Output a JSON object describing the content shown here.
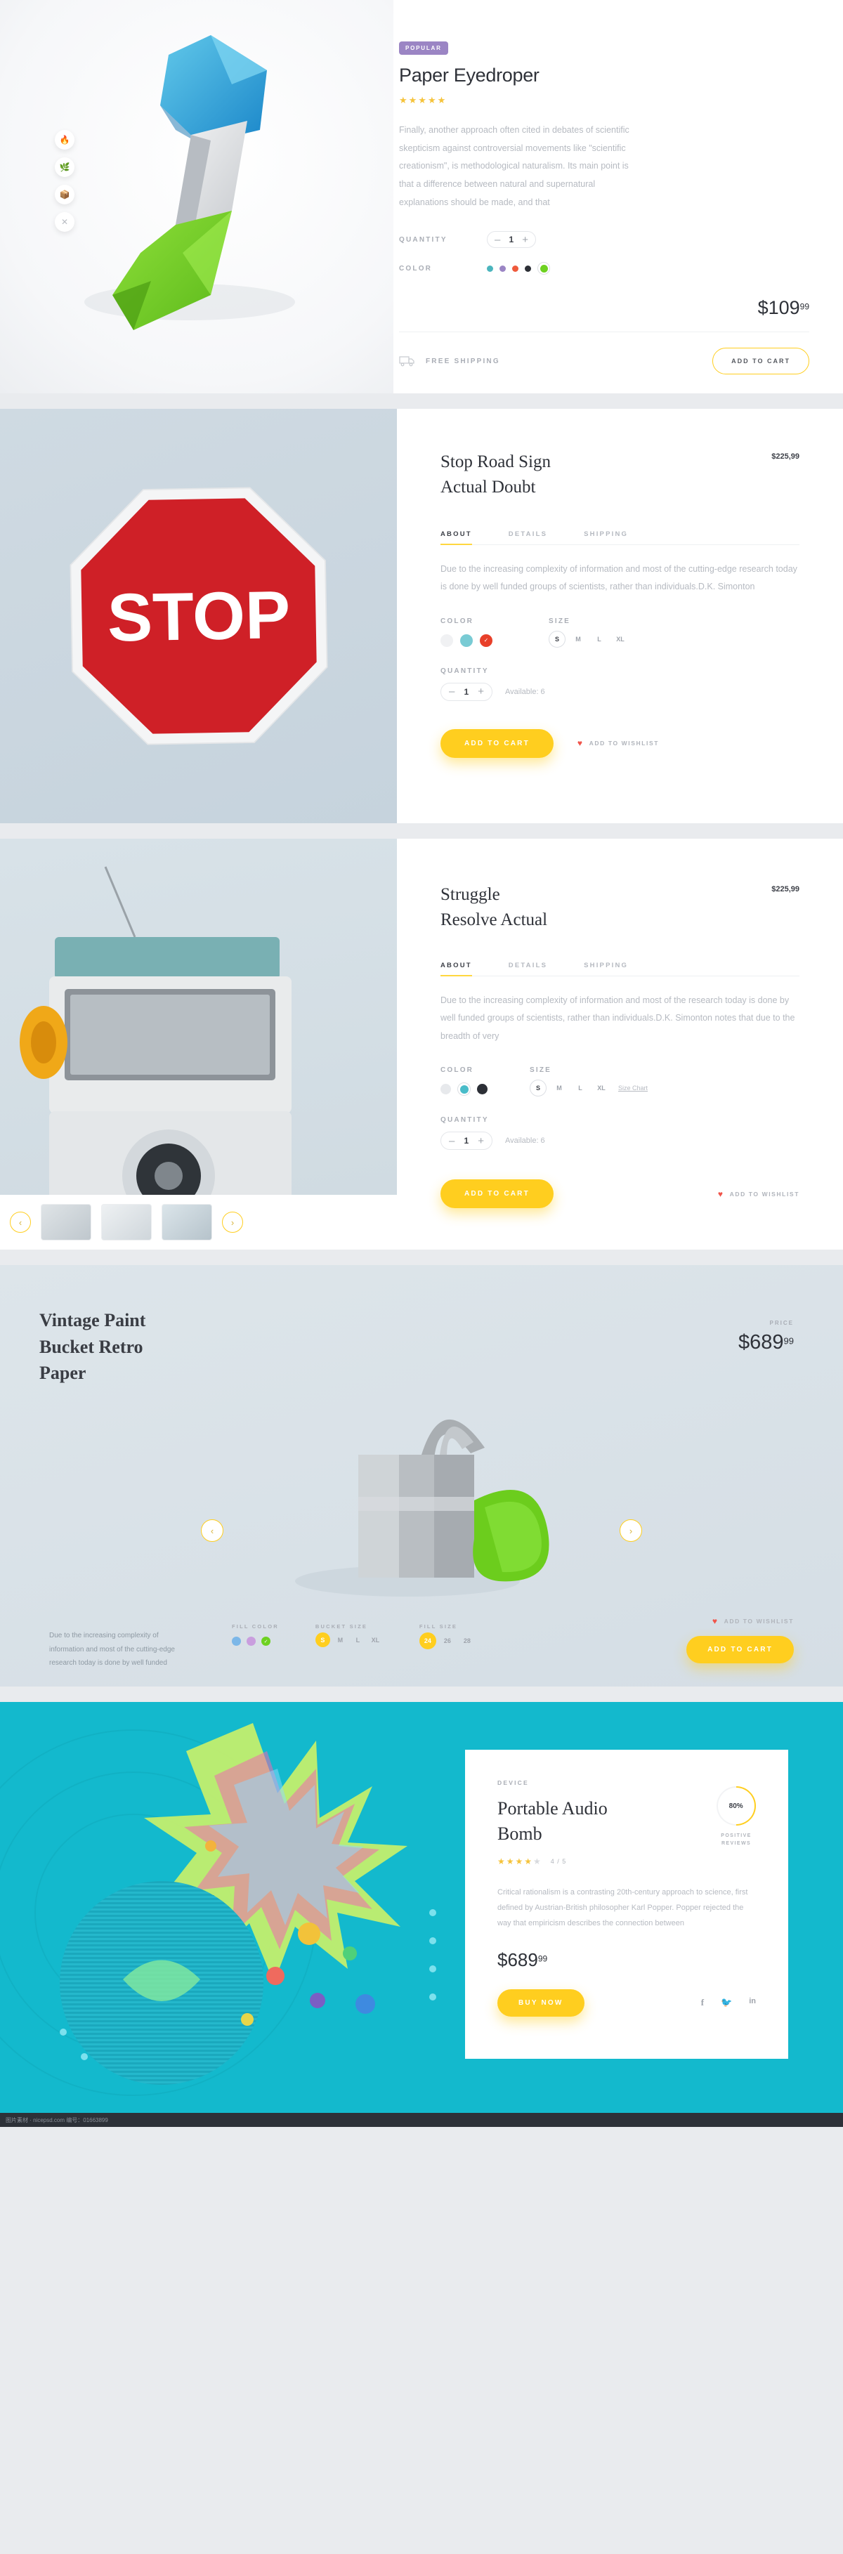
{
  "sections": {
    "s1": {
      "badge": "POPULAR",
      "title": "Paper Eyedroper",
      "rating_stars": 5,
      "description": "Finally, another approach often cited in debates of scientific skepticism against controversial movements like \"scientific creationism\", is methodological naturalism. Its main point is that a difference between natural and supernatural explanations should be made, and that",
      "quantity_label": "QUANTITY",
      "quantity_value": "1",
      "minus": "–",
      "plus": "+",
      "color_label": "COLOR",
      "colors": [
        "#4bb5bd",
        "#9b85c4",
        "#ef5a3c",
        "#2c2f36",
        "#6ed121"
      ],
      "selected_color_index": 4,
      "price_main": "$109",
      "price_cents": "99",
      "shipping_label": "FREE SHIPPING",
      "shipping_icon": "truck-icon",
      "cart_label": "ADD TO CART",
      "side_icons": [
        "fire-icon",
        "leaf-icon",
        "box-icon",
        "close-icon"
      ]
    },
    "s2": {
      "title_line1": "Stop Road Sign",
      "title_line2": "Actual Doubt",
      "price": "$225,99",
      "tabs": [
        {
          "label": "ABOUT",
          "active": true
        },
        {
          "label": "DETAILS",
          "active": false
        },
        {
          "label": "SHIPPING",
          "active": false
        }
      ],
      "description": "Due to the increasing complexity of information and most of the cutting-edge research today is done by well funded groups of scientists, rather than individuals.D.K. Simonton",
      "color_label": "COLOR",
      "colors": [
        "#f0f1f3",
        "#79cbd4",
        "#e8402a"
      ],
      "selected_color_index": 2,
      "size_label": "SIZE",
      "sizes": [
        "S",
        "M",
        "L",
        "XL"
      ],
      "selected_size": "S",
      "quantity_label": "QUANTITY",
      "quantity_value": "1",
      "minus": "–",
      "plus": "+",
      "available": "Available: 6",
      "cart_label": "ADD TO CART",
      "wishlist_label": "ADD TO WISHLIST",
      "sign_text": "STOP"
    },
    "s3": {
      "title_line1": "Struggle",
      "title_line2": "Resolve Actual",
      "price": "$225,99",
      "tabs": [
        {
          "label": "ABOUT",
          "active": true
        },
        {
          "label": "DETAILS",
          "active": false
        },
        {
          "label": "SHIPPING",
          "active": false
        }
      ],
      "description": "Due to the increasing complexity of information and most of the research today is done by well funded groups of scientists, rather than individuals.D.K. Simonton notes that due to the breadth of very",
      "color_label": "COLOR",
      "colors": [
        "#e7e9ec",
        "#49bcc9",
        "#2c2f36"
      ],
      "selected_color_index": 1,
      "size_label": "SIZE",
      "sizes": [
        "S",
        "M",
        "L",
        "XL"
      ],
      "selected_size": "S",
      "size_chart_label": "Size Chart",
      "quantity_label": "QUANTITY",
      "quantity_value": "1",
      "minus": "–",
      "plus": "+",
      "available": "Available: 6",
      "cart_label": "ADD TO CART",
      "wishlist_label": "ADD TO WISHLIST",
      "prev_icon": "arrow-left-icon",
      "next_icon": "arrow-right-icon"
    },
    "s4": {
      "title_line1": "Vintage Paint",
      "title_line2": "Bucket Retro",
      "title_line3": "Paper",
      "price_label": "PRICE",
      "price_main": "$689",
      "price_cents": "99",
      "description": "Due to the increasing complexity of information and most of the cutting-edge research today is done by well funded",
      "fill_color_label": "FILL COLOR",
      "fill_colors": [
        "#7cb7e8",
        "#c99ede",
        "#6ed121"
      ],
      "selected_fill_color_index": 2,
      "bucket_size_label": "BUCKET SIZE",
      "bucket_sizes": [
        "S",
        "M",
        "L",
        "XL"
      ],
      "selected_bucket_size": "S",
      "fill_size_label": "FILL SIZE",
      "fill_sizes": [
        "24",
        "26",
        "28"
      ],
      "selected_fill_size": "24",
      "wishlist_label": "ADD TO WISHLIST",
      "cart_label": "ADD TO CART",
      "prev_icon": "arrow-left-icon",
      "next_icon": "arrow-right-icon"
    },
    "s5": {
      "eyebrow": "DEVICE",
      "title_line1": "Portable Audio",
      "title_line2": "Bomb",
      "rating_stars": 4,
      "rating_text": "4 / 5",
      "score_value": "80%",
      "score_caption_line1": "POSITIVE",
      "score_caption_line2": "REVIEWS",
      "description": "Critical rationalism is a contrasting 20th-century approach to science, first defined by Austrian-British philosopher Karl Popper. Popper rejected the way that empiricism describes the connection between",
      "price_main": "$689",
      "price_cents": "99",
      "buy_label": "BUY NOW",
      "social": [
        "facebook-icon",
        "twitter-icon",
        "linkedin-icon"
      ]
    }
  },
  "footer": {
    "text": "图片素材 · nicepsd.com  编号：01663899"
  }
}
